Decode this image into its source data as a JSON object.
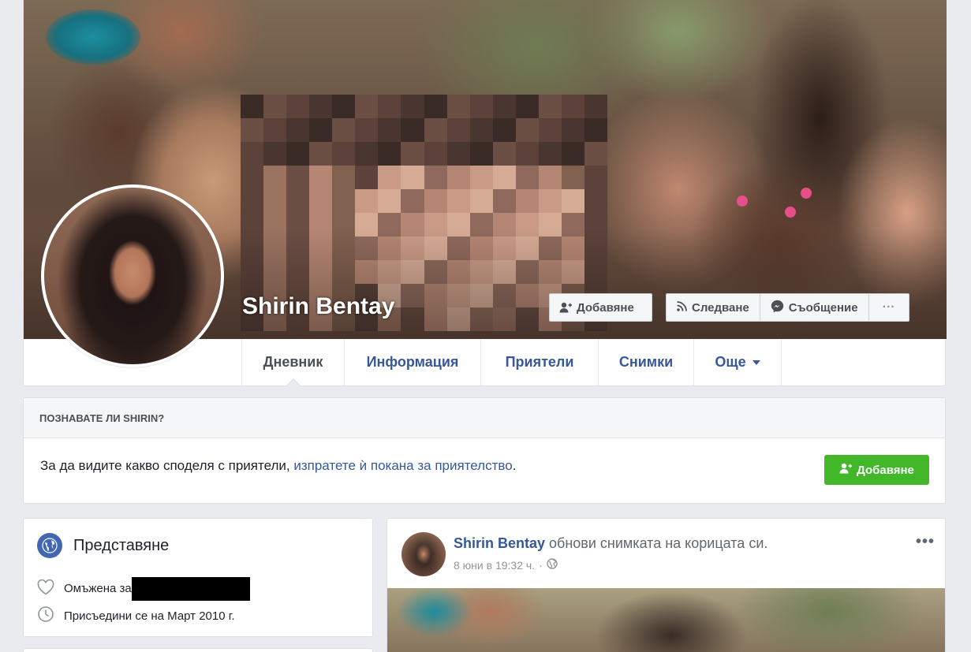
{
  "profile": {
    "name": "Shirin Bentay"
  },
  "actions": {
    "add_friend": "Добавяне",
    "follow": "Следване",
    "message": "Съобщение",
    "more": "···"
  },
  "tabs": [
    {
      "label": "Дневник",
      "active": true
    },
    {
      "label": "Информация",
      "active": false
    },
    {
      "label": "Приятели",
      "active": false
    },
    {
      "label": "Снимки",
      "active": false
    },
    {
      "label": "Още",
      "active": false
    }
  ],
  "know_card": {
    "heading": "ПОЗНАВАТЕ ЛИ SHIRIN?",
    "text_prefix": "За да видите какво споделя с приятели, ",
    "text_link": "изпратете ѝ покана за приятелство",
    "text_suffix": ".",
    "button": "Добавяне"
  },
  "intro": {
    "title": "Представяне",
    "married_label": "Омъжена за",
    "joined": "Присъедини се на Март 2010 г."
  },
  "post": {
    "author": "Shirin Bentay",
    "action": " обнови снимката на корицата си.",
    "time": "8 юни в 19:32 ч.",
    "separator": "·",
    "more": "•••"
  },
  "colors": {
    "link_blue": "#365899",
    "green": "#42b72a",
    "page_bg": "#e9ebee"
  }
}
